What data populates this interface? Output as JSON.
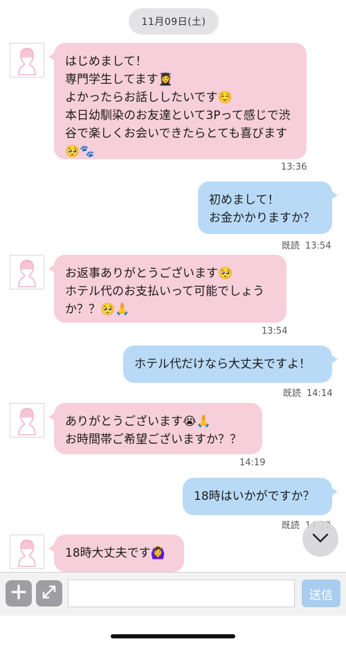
{
  "date_label": "11月09日(土)",
  "messages": [
    {
      "side": "in",
      "text": "はじめまして！\n専門学生してます👩‍🎓\nよかったらお話ししたいです☺️\n本日幼馴染のお友達といて3Pって感じで渋谷で楽しくお会いできたらとても喜びます🥺🐾",
      "time": "13:36"
    },
    {
      "side": "out",
      "text": "初めまして！\nお金かかりますか？",
      "read": "既読",
      "time": "13:54"
    },
    {
      "side": "in",
      "text": "お返事ありがとうございます🥺\nホテル代のお支払いって可能でしょうか？？🥺🙏",
      "time": "13:54"
    },
    {
      "side": "out",
      "text": "ホテル代だけなら大丈夫ですよ！",
      "read": "既読",
      "time": "14:14"
    },
    {
      "side": "in",
      "text": "ありがとうございます😭🙏\nお時間帯ご希望ございますか？？",
      "time": "14:19"
    },
    {
      "side": "out",
      "text": "18時はいかがですか？",
      "read": "既読",
      "time": "14:22"
    },
    {
      "side": "in",
      "text": "18時大丈夫です🙆‍♀️"
    }
  ],
  "icons": {
    "avatar": "female-silhouette-avatar",
    "scroll": "chevron-down-icon",
    "plus": "plus-icon",
    "expand": "expand-icon"
  },
  "input": {
    "value": "",
    "placeholder": ""
  },
  "send_label": "送信",
  "colors": {
    "incoming_bubble": "#f7cfdb",
    "outgoing_bubble": "#b9daf7",
    "send_button": "#a9cdee",
    "date_pill": "#e3e3e5"
  }
}
